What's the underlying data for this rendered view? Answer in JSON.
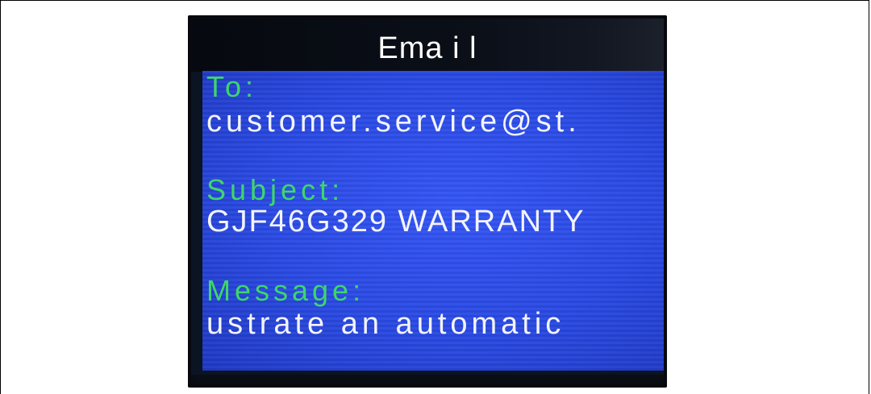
{
  "email_screen": {
    "title": "Ema i l",
    "to_label": "To:",
    "to_value": "customer.service@st.",
    "subject_label": "Subject:",
    "subject_value": "GJF46G329 WARRANTY",
    "message_label": "Message:",
    "message_value": "ustrate an automatic"
  },
  "colors": {
    "screen_background": "#2a4ae3",
    "label_text": "#3ed66b",
    "value_text": "#f2f3ff",
    "title_text": "#ffffff"
  }
}
